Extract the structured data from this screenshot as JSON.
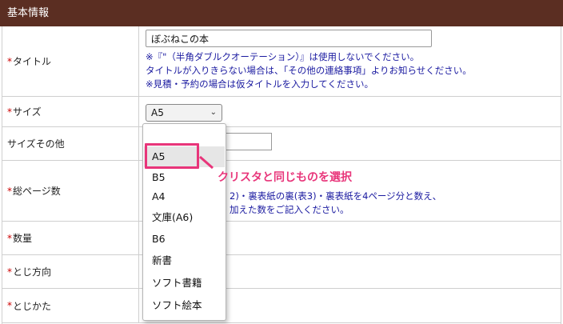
{
  "header": {
    "title": "基本情報"
  },
  "rows": {
    "title": {
      "label": "タイトル",
      "value": "ぼぶねこの本"
    },
    "size": {
      "label": "サイズ",
      "selected": "A5"
    },
    "size_other": {
      "label": "サイズその他"
    },
    "pages": {
      "label": "総ページ数"
    },
    "quantity": {
      "label": "数量"
    },
    "binding_dir": {
      "label": "とじ方向"
    },
    "binding_type": {
      "label": "とじかた"
    }
  },
  "title_notes": [
    "※『\"（半角ダブルクオーテーション）』は使用しないでください。",
    "タイトルが入りきらない場合は、「その他の連絡事項」よりお知らせください。",
    "※見積・予約の場合は仮タイトルを入力してください。"
  ],
  "pages_notes": [
    "2)・裏表紙の裏(表3)・裏表紙を4ページ分と数え、",
    "加えた数をご記入ください。"
  ],
  "dropdown": {
    "options": [
      "A5",
      "B5",
      "A4",
      "文庫(A6)",
      "B6",
      "新書",
      "ソフト書籍",
      "ソフト絵本"
    ]
  },
  "annotation": {
    "text": "クリスタと同じものを選択"
  },
  "required_mark": "*",
  "colors": {
    "header_bg": "#5b2e22",
    "annotation": "#e8357a",
    "note_text": "#1a1aa0",
    "required": "#cc0000"
  }
}
